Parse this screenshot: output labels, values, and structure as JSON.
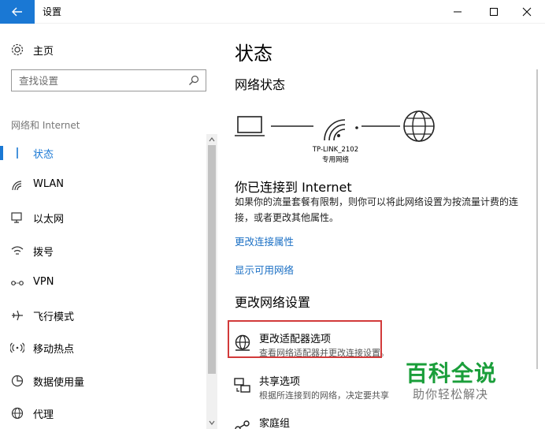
{
  "window": {
    "title": "设置",
    "back_icon": "arrow-left-icon",
    "controls": [
      "minimize-icon",
      "maximize-icon",
      "close-icon"
    ]
  },
  "sidebar": {
    "home_label": "主页",
    "search_placeholder": "查找设置",
    "section_title": "网络和 Internet",
    "items": [
      {
        "label": "状态",
        "icon": "status-icon",
        "active": true
      },
      {
        "label": "WLAN",
        "icon": "wifi-icon",
        "active": false
      },
      {
        "label": "以太网",
        "icon": "ethernet-icon",
        "active": false
      },
      {
        "label": "拨号",
        "icon": "dialup-icon",
        "active": false
      },
      {
        "label": "VPN",
        "icon": "vpn-icon",
        "active": false
      },
      {
        "label": "飞行模式",
        "icon": "airplane-icon",
        "active": false
      },
      {
        "label": "移动热点",
        "icon": "hotspot-icon",
        "active": false
      },
      {
        "label": "数据使用量",
        "icon": "data-usage-icon",
        "active": false
      },
      {
        "label": "代理",
        "icon": "globe-icon",
        "active": false
      }
    ]
  },
  "main": {
    "title": "状态",
    "network_status_heading": "网络状态",
    "network": {
      "name": "TP-LINK_2102",
      "type": "专用网络"
    },
    "connected_heading": "你已连接到 Internet",
    "connected_desc": "如果你的流量套餐有限制，则你可以将此网络设置为按流量计费的连接，或者更改其他属性。",
    "links": {
      "change_props": "更改连接属性",
      "show_networks": "显示可用网络"
    },
    "change_heading": "更改网络设置",
    "options": [
      {
        "title": "更改适配器选项",
        "desc": "查看网络适配器并更改连接设置。",
        "icon": "adapter-icon"
      },
      {
        "title": "共享选项",
        "desc": "根据所连接到的网络，决定要共享",
        "icon": "sharing-icon"
      },
      {
        "title": "家庭组",
        "desc": "",
        "icon": "homegroup-icon"
      }
    ]
  },
  "watermark": {
    "line1": "百科全说",
    "line2": "助你轻松解决",
    "color": "#1a9e3a"
  },
  "colors": {
    "accent": "#1a78d4",
    "link": "#1a6fc4",
    "highlight_border": "#d23a3a"
  }
}
